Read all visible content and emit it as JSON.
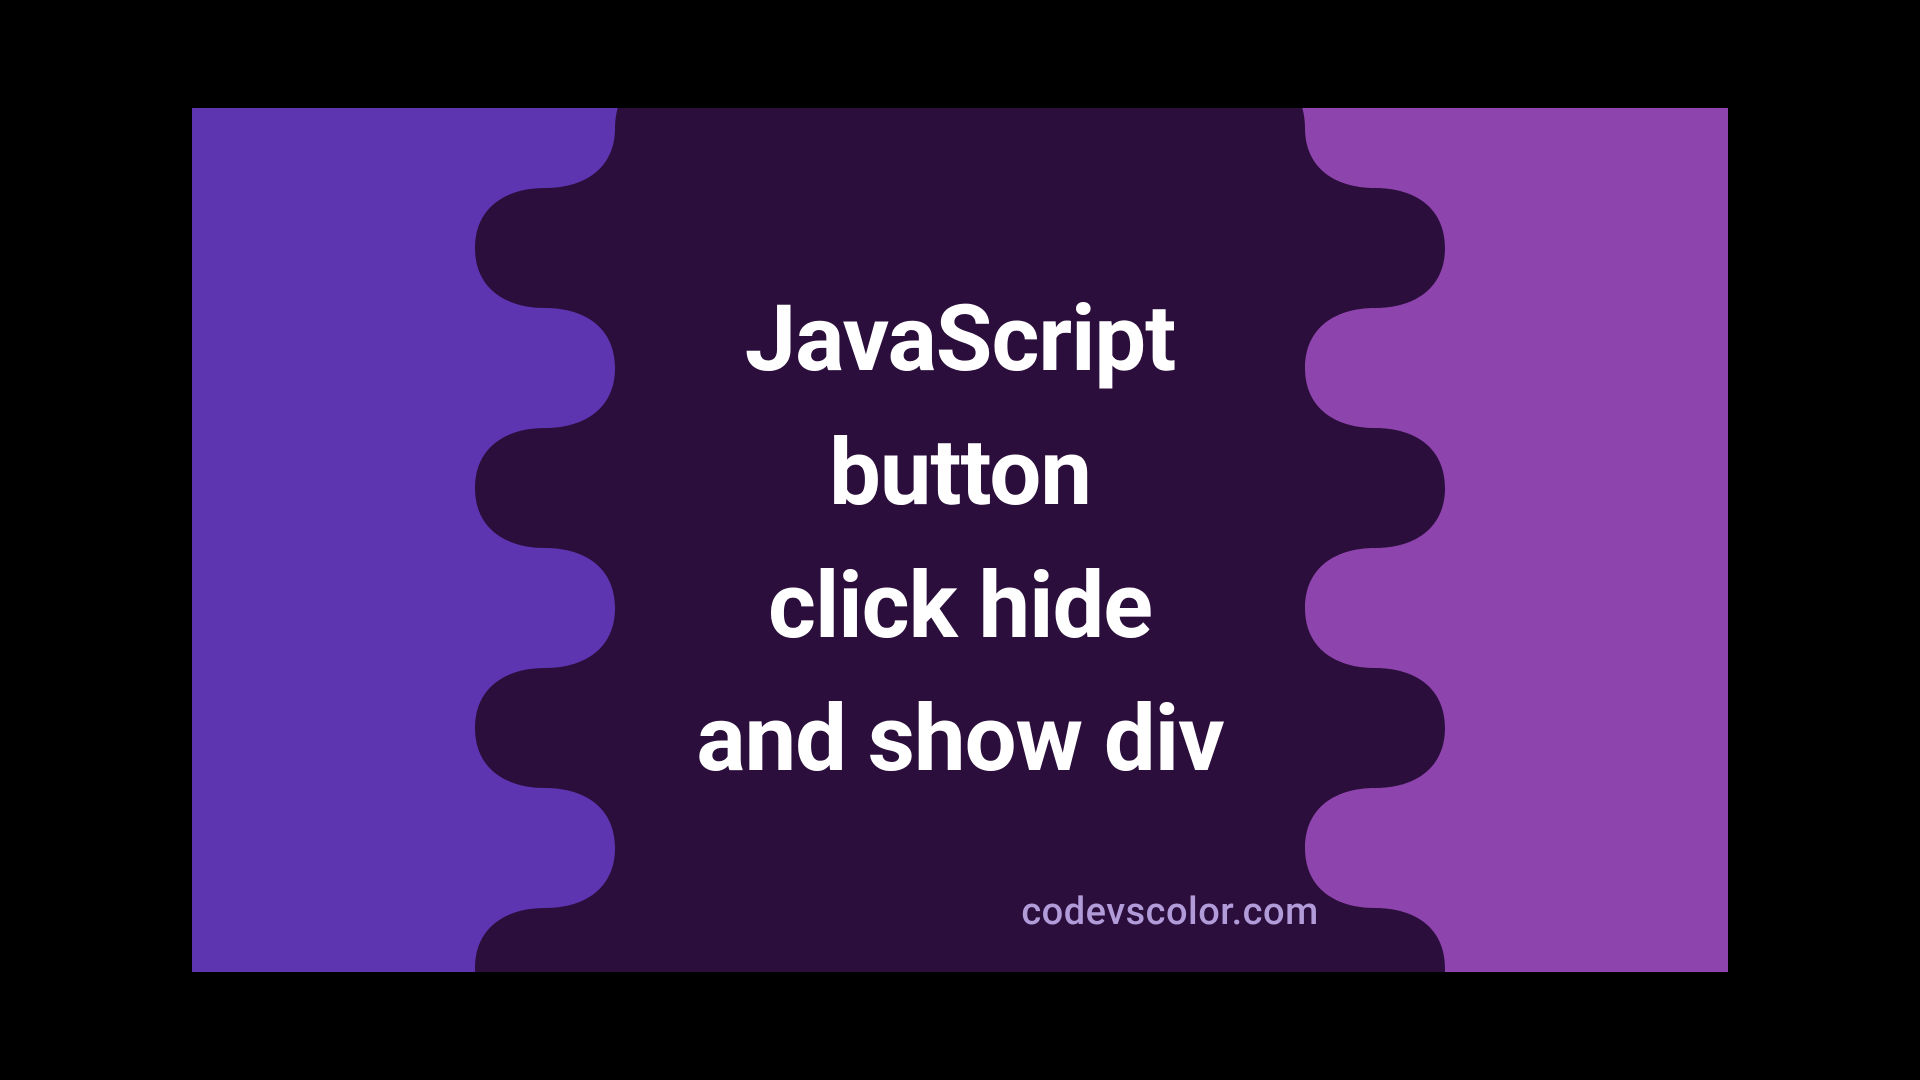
{
  "title_line1": "JavaScript",
  "title_line2": "button",
  "title_line3": "click hide",
  "title_line4": "and show div",
  "watermark": "codevscolor.com",
  "colors": {
    "bg_left": "#5E35B1",
    "bg_right": "#8E44AD",
    "blob": "#2B0E3C",
    "text": "#ffffff",
    "watermark": "#b19cd9"
  }
}
